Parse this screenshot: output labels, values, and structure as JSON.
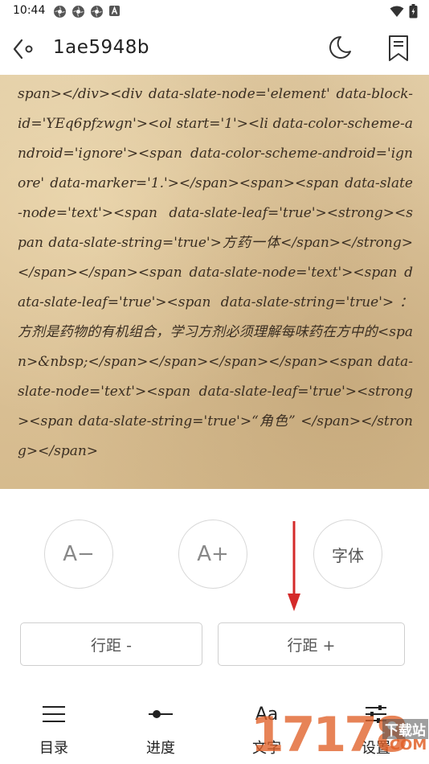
{
  "status_bar": {
    "time": "10:44"
  },
  "header": {
    "title": "1ae5948b"
  },
  "reader": {
    "content": "span></div><div data-slate-node='element' data-block-id='YEq6pfzwgn'><ol start='1'><li data-color-scheme-android='ignore'><span data-color-scheme-android='ignore' data-marker='1.'></span><span><span data-slate-node='text'><span data-slate-leaf='true'><strong><span data-slate-string='true'>方药一体</span></strong></span></span><span data-slate-node='text'><span data-slate-leaf='true'><span data-slate-string='true'>：方剂是药物的有机组合，学习方剂必须理解每味药在方中的<span>&nbsp;</span></span></span></span><span data-slate-node='text'><span data-slate-leaf='true'><strong><span data-slate-string='true'>“角色” </span></strong></span>"
  },
  "settings": {
    "font_decrease": "A−",
    "font_increase": "A+",
    "font_face": "字体",
    "line_spacing_decrease": "行距 -",
    "line_spacing_increase": "行距 +"
  },
  "nav": {
    "toc": "目录",
    "progress": "进度",
    "text": "文字",
    "text_icon": "Aa",
    "settings": "设置"
  },
  "watermark": {
    "number": "17178",
    "sub": "下载站",
    "com": ".COM"
  },
  "colors": {
    "accent_arrow": "#d42a2a",
    "paper": "#dcc399"
  }
}
